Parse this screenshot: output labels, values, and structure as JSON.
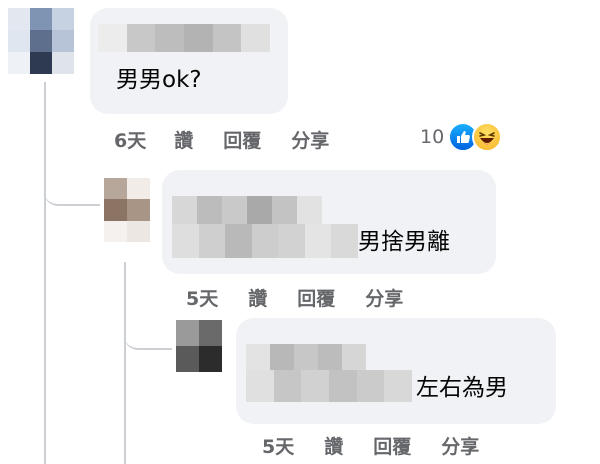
{
  "thread": {
    "comments": [
      {
        "text": "男男ok?",
        "time": "6天",
        "like": "讚",
        "reply": "回覆",
        "share": "分享",
        "reaction_count": "10",
        "reaction_icons": [
          "like-icon",
          "haha-icon"
        ]
      },
      {
        "text": "男捨男離",
        "time": "5天",
        "like": "讚",
        "reply": "回覆",
        "share": "分享"
      },
      {
        "text": "左右為男",
        "time": "5天",
        "like": "讚",
        "reply": "回覆",
        "share": "分享"
      }
    ]
  },
  "colors": {
    "bubble": "#f0f2f5",
    "action_text": "#65676b",
    "thread_line": "#ccd0d5",
    "like_blue": "#1877f2"
  }
}
